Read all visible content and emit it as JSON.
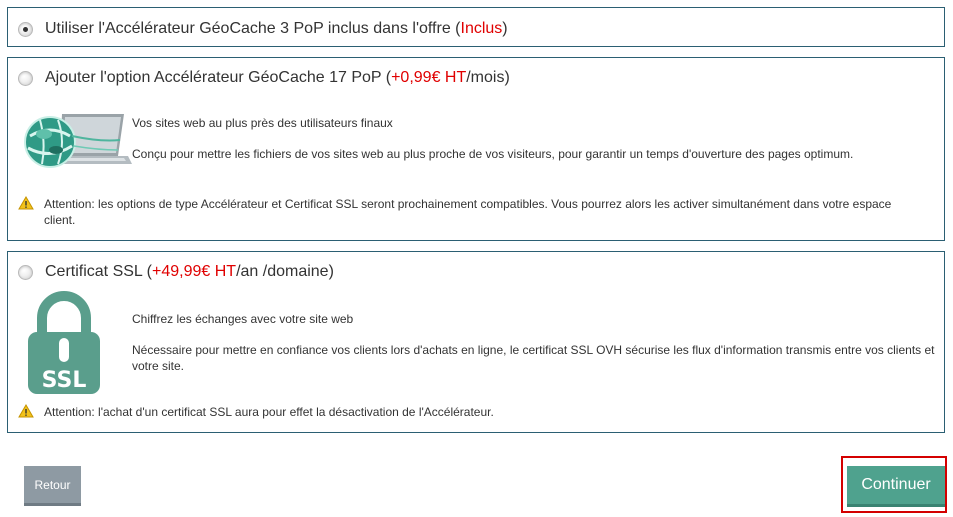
{
  "options": [
    {
      "label_prefix": "Utiliser l'Accélérateur GéoCache 3 PoP inclus dans l'offre (",
      "price": "Inclus",
      "label_suffix": ")",
      "checked": true
    },
    {
      "label_prefix": "Ajouter l'option Accélérateur GéoCache 17 PoP (",
      "price": "+0,99€ HT",
      "label_suffix": "/mois)",
      "checked": false,
      "image_icon": "geocache-globe-laptop-icon",
      "description_title": "Vos sites web au plus près des utilisateurs finaux",
      "description_text": "Conçu pour mettre les fichiers de vos sites web au plus proche de vos visiteurs, pour garantir un temps d'ouverture des pages optimum.",
      "warning": "Attention: les options de type Accélérateur et Certificat SSL seront prochainement compatibles. Vous pourrez alors les activer simultanément dans votre espace client."
    },
    {
      "label_prefix": "Certificat SSL (",
      "price": "+49,99€ HT",
      "label_suffix": "/an /domaine)",
      "checked": false,
      "image_icon": "ssl-padlock-icon",
      "image_text": "SSL",
      "description_title": "Chiffrez les échanges avec votre site web",
      "description_text": "Nécessaire pour mettre en confiance vos clients lors d'achats en ligne, le certificat SSL OVH sécurise les flux d'information transmis entre vos clients et votre site.",
      "warning": "Attention: l'achat d'un certificat SSL aura pour effet la désactivation de l'Accélérateur."
    }
  ],
  "buttons": {
    "back_label": "Retour",
    "continue_label": "Continuer"
  },
  "colors": {
    "border": "#2b5f73",
    "price": "#e00000",
    "continue_bg": "#4fa28e",
    "back_bg": "#8e9aa3",
    "highlight": "#d40000",
    "ssl_green": "#5a9e8c"
  }
}
